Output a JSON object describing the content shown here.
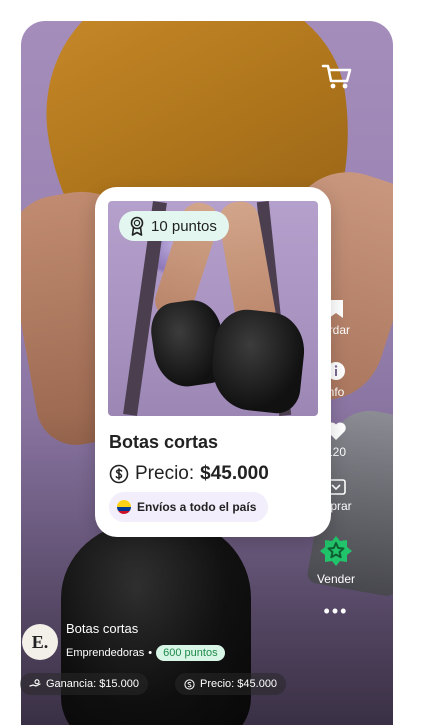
{
  "product_card": {
    "points_badge": "10 puntos",
    "title": "Botas cortas",
    "price_label": "Precio:",
    "price_value": "$45.000",
    "shipping": "Envíos a todo el país"
  },
  "side_actions": {
    "save_label": "ardar",
    "info_label": "nfo",
    "like_count": "120",
    "buy_label": "mprar",
    "sell_label": "Vender",
    "more_label": "•••"
  },
  "vendor": {
    "avatar_letter": "E.",
    "product_name": "Botas cortas",
    "store_name": "Emprendedoras",
    "separator": "•",
    "points": "600 puntos"
  },
  "chips": {
    "gain": "Ganancia: $15.000",
    "price": "Precio: $45.000"
  },
  "colors": {
    "accent_green": "#21c46a",
    "badge_mint": "#e3f7f0",
    "ship_lavender": "#f3eefb"
  }
}
